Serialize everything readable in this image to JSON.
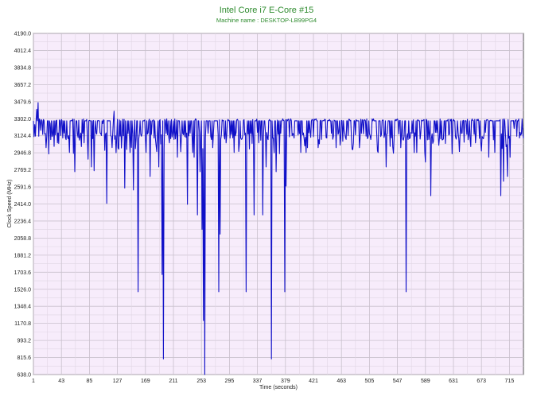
{
  "chart_data": {
    "type": "line",
    "title": "Intel Core i7 E-Core #15",
    "subtitle": "Machine name : DESKTOP-LB99PG4",
    "xlabel": "Time (seconds)",
    "ylabel": "Clock Speed (MHz)",
    "xlim": [
      1,
      736
    ],
    "ylim": [
      638.0,
      4190.0
    ],
    "x_ticks": [
      "1",
      "43",
      "85",
      "127",
      "169",
      "211",
      "253",
      "295",
      "337",
      "379",
      "421",
      "463",
      "505",
      "547",
      "589",
      "631",
      "673",
      "715"
    ],
    "y_ticks": [
      "4190.0",
      "4012.4",
      "3834.8",
      "3657.2",
      "3479.6",
      "3302.0",
      "3124.4",
      "2946.8",
      "2769.2",
      "2591.6",
      "2414.0",
      "2236.4",
      "2058.8",
      "1881.2",
      "1703.6",
      "1526.0",
      "1348.4",
      "1170.8",
      "993.2",
      "815.6",
      "638.0"
    ],
    "grid": true,
    "colors": {
      "line": "#1010c8",
      "plot_bg": "#f7ecfb",
      "grid": "#c8c0cc",
      "title": "#2e8b2e"
    },
    "series": [
      {
        "baseline": 3280,
        "points": [
          [
            1,
            3280
          ],
          [
            3,
            3240
          ],
          [
            4,
            3120
          ],
          [
            6,
            3400
          ],
          [
            8,
            3470
          ],
          [
            10,
            3300
          ],
          [
            12,
            3180
          ],
          [
            14,
            3280
          ],
          [
            20,
            3000
          ],
          [
            26,
            3250
          ],
          [
            37,
            3050
          ],
          [
            45,
            3100
          ],
          [
            55,
            2950
          ],
          [
            63,
            2750
          ],
          [
            77,
            3050
          ],
          [
            83,
            2880
          ],
          [
            88,
            2800
          ],
          [
            92,
            2760
          ],
          [
            105,
            3250
          ],
          [
            111,
            2420
          ],
          [
            122,
            3380
          ],
          [
            131,
            3120
          ],
          [
            138,
            2580
          ],
          [
            146,
            2950
          ],
          [
            151,
            2560
          ],
          [
            158,
            1500
          ],
          [
            164,
            3150
          ],
          [
            170,
            2950
          ],
          [
            176,
            2700
          ],
          [
            182,
            3100
          ],
          [
            189,
            2800
          ],
          [
            194,
            1680
          ],
          [
            196,
            800
          ],
          [
            205,
            3050
          ],
          [
            217,
            2900
          ],
          [
            232,
            2410
          ],
          [
            242,
            2900
          ],
          [
            247,
            2300
          ],
          [
            251,
            2750
          ],
          [
            254,
            2150
          ],
          [
            256,
            1200
          ],
          [
            258,
            638
          ],
          [
            263,
            3150
          ],
          [
            270,
            3000
          ],
          [
            279,
            1500
          ],
          [
            281,
            2100
          ],
          [
            290,
            3050
          ],
          [
            302,
            2950
          ],
          [
            312,
            3100
          ],
          [
            320,
            1500
          ],
          [
            327,
            3150
          ],
          [
            332,
            2300
          ],
          [
            339,
            3050
          ],
          [
            345,
            2300
          ],
          [
            350,
            2800
          ],
          [
            358,
            800
          ],
          [
            365,
            2750
          ],
          [
            372,
            3150
          ],
          [
            378,
            1500
          ],
          [
            380,
            2600
          ],
          [
            392,
            3100
          ],
          [
            402,
            2950
          ],
          [
            410,
            2950
          ],
          [
            416,
            3170
          ],
          [
            428,
            3000
          ],
          [
            441,
            3100
          ],
          [
            455,
            3000
          ],
          [
            467,
            3180
          ],
          [
            478,
            3100
          ],
          [
            490,
            3000
          ],
          [
            500,
            3120
          ],
          [
            508,
            3150
          ],
          [
            518,
            2950
          ],
          [
            530,
            2800
          ],
          [
            542,
            3100
          ],
          [
            552,
            3000
          ],
          [
            560,
            1500
          ],
          [
            566,
            3100
          ],
          [
            574,
            3120
          ],
          [
            589,
            2850
          ],
          [
            597,
            2500
          ],
          [
            610,
            3100
          ],
          [
            625,
            3140
          ],
          [
            641,
            3150
          ],
          [
            654,
            3130
          ],
          [
            664,
            3050
          ],
          [
            675,
            3100
          ],
          [
            684,
            2900
          ],
          [
            693,
            2950
          ],
          [
            702,
            2500
          ],
          [
            706,
            2650
          ],
          [
            712,
            2700
          ],
          [
            716,
            2900
          ],
          [
            722,
            3200
          ],
          [
            730,
            3100
          ]
        ]
      }
    ]
  }
}
